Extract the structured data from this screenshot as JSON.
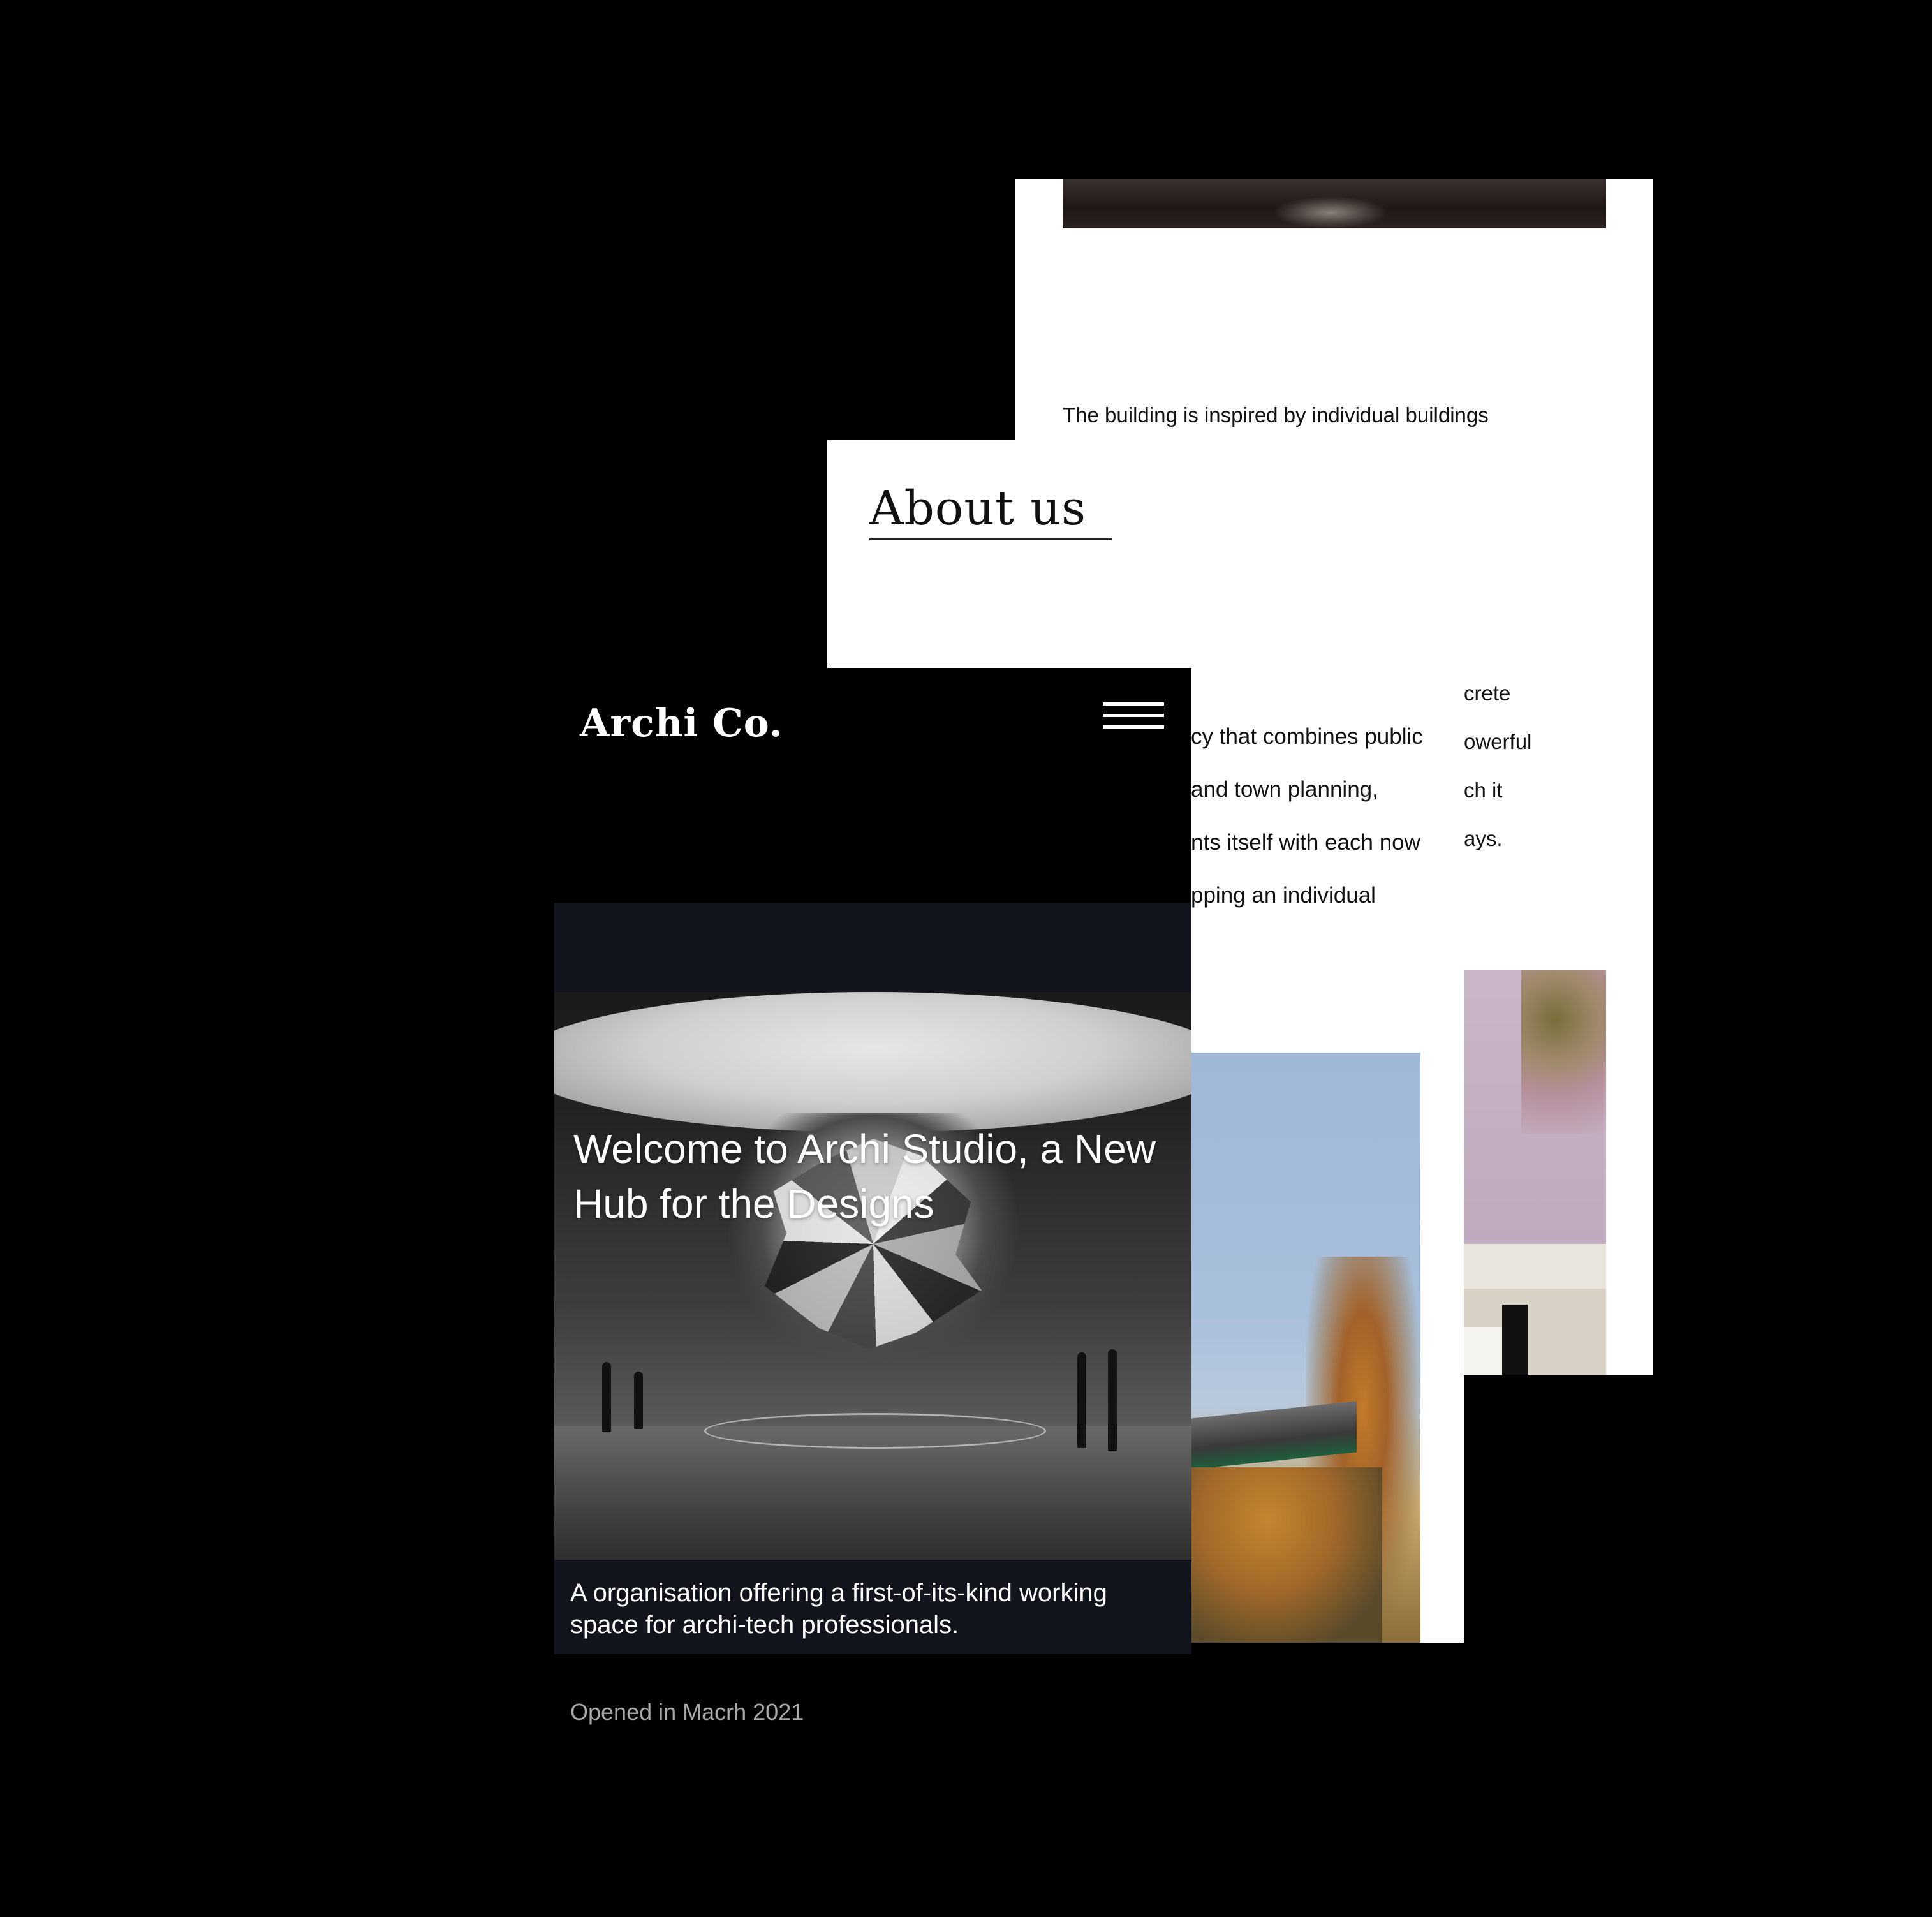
{
  "back_page": {
    "caption": "The building is inspired by individual buildings",
    "text_lines": [
      "crete",
      "owerful",
      "ch it",
      "ays."
    ]
  },
  "about_page": {
    "heading": "About us",
    "text_lines": [
      "cy that combines public",
      "and town planning,",
      "nts itself with each now",
      "pping an individual"
    ]
  },
  "home_page": {
    "logo": "Archi Co.",
    "menu_icon": "hamburger-menu-icon",
    "hero_title": "Welcome to Archi Studio, a New Hub for the Designs",
    "subtitle": "A organisation offering a first-of-its-kind working space for archi-tech professionals.",
    "opened": "Opened in Macrh 2021"
  }
}
